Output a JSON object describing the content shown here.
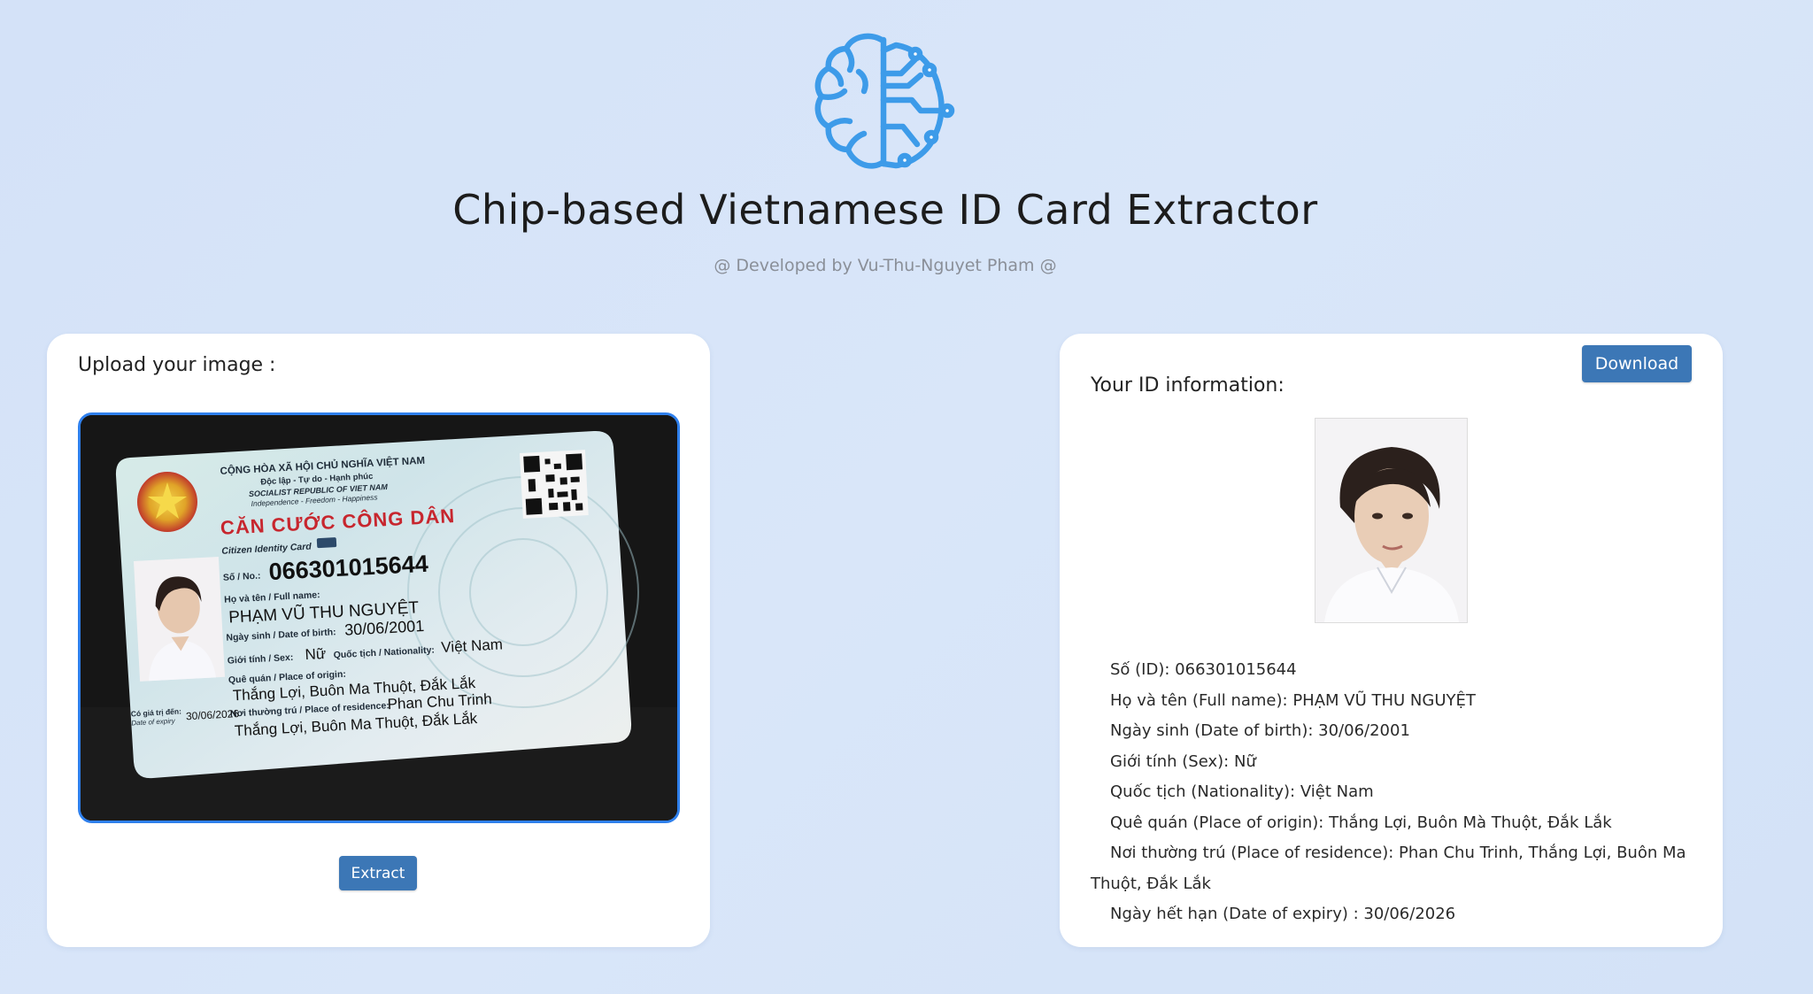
{
  "header": {
    "title": "Chip-based Vietnamese ID Card Extractor",
    "subtitle": "@ Developed by Vu-Thu-Nguyet Pham @",
    "logo_icon": "brain-circuit-icon",
    "accent_color": "#3d9be9"
  },
  "upload": {
    "label": "Upload your image :",
    "extract_button": "Extract",
    "id_card": {
      "country_line_1": "CỘNG HÒA XÃ HỘI CHỦ NGHĨA VIỆT NAM",
      "country_line_2": "Độc lập - Tự do - Hạnh phúc",
      "country_line_3": "SOCIALIST REPUBLIC OF VIET NAM",
      "country_line_4": "Independence - Freedom - Happiness",
      "card_title": "CĂN CƯỚC CÔNG DÂN",
      "card_subtitle": "Citizen Identity Card",
      "number_label": "Số / No.:",
      "number": "066301015644",
      "name_label": "Họ và tên / Full name:",
      "name": "PHẠM VŨ THU NGUYỆT",
      "dob_label": "Ngày sinh / Date of birth:",
      "dob": "30/06/2001",
      "sex_label": "Giới tính / Sex:",
      "sex": "Nữ",
      "nationality_label": "Quốc tịch / Nationality:",
      "nationality": "Việt Nam",
      "origin_label": "Quê quán / Place of origin:",
      "origin": "Thắng Lợi, Buôn Ma Thuột, Đắk Lắk",
      "residence_label": "Nơi thường trú / Place of residence:",
      "residence_1": "Phan Chu Trinh",
      "residence_2": "Thắng Lợi, Buôn Ma Thuột, Đắk Lắk",
      "expiry_label_1": "Có giá trị đến:",
      "expiry_label_2": "Date of expiry",
      "expiry": "30/06/2026"
    }
  },
  "result": {
    "label": "Your ID information:",
    "download_button": "Download",
    "fields": [
      "Số (ID): 066301015644",
      "Họ và tên (Full name): PHẠM VŨ THU NGUYỆT",
      "Ngày sinh (Date of birth): 30/06/2001",
      "Giới tính (Sex): Nữ",
      "Quốc tịch (Nationality): Việt Nam",
      "Quê quán (Place of origin): Thắng Lợi, Buôn Mà Thuột, Đắk Lắk",
      "Nơi thường trú (Place of residence): Phan Chu Trinh, Thắng Lợi, Buôn Ma Thuột, Đắk Lắk",
      "Ngày hết hạn (Date of expiry) : 30/06/2026"
    ]
  }
}
